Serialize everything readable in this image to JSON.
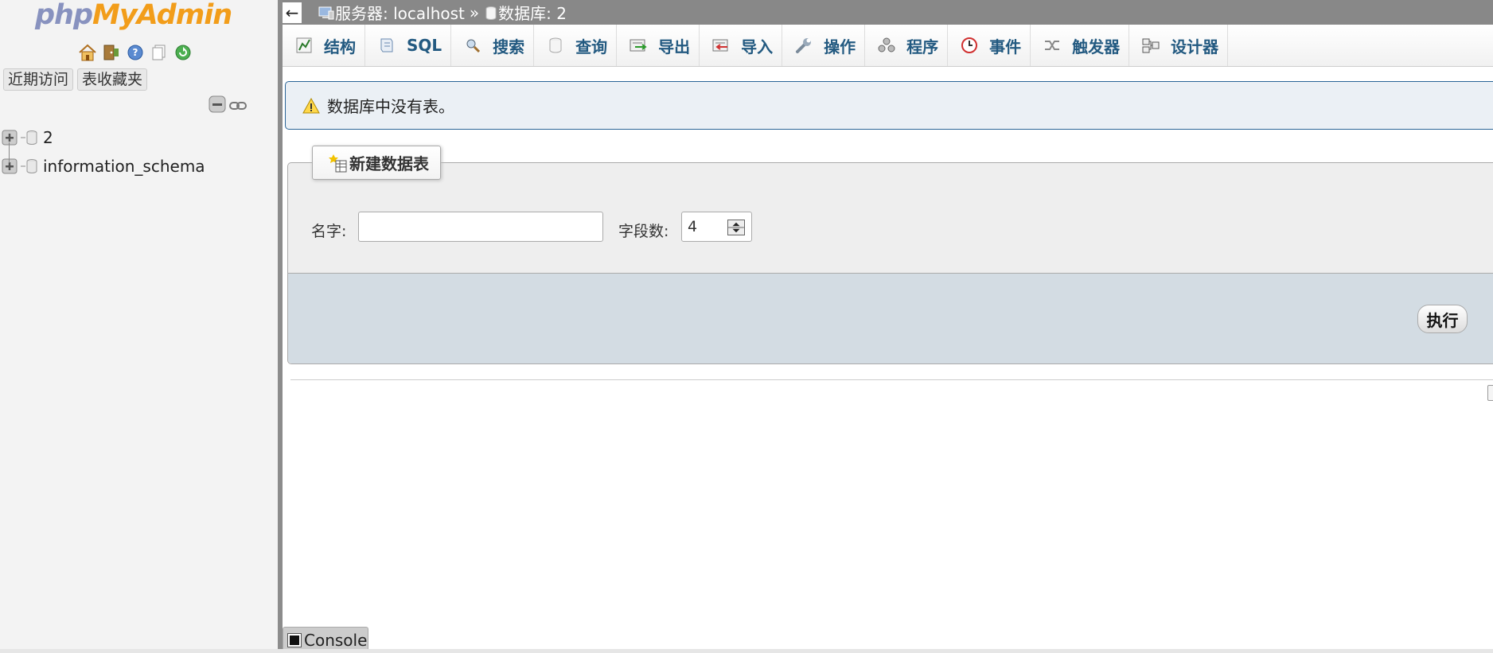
{
  "app": {
    "logo_php": "php",
    "logo_myadmin": "MyAdmin"
  },
  "nav": {
    "icons": [
      "home-icon",
      "exit-icon",
      "help-icon",
      "docs-icon",
      "reload-icon"
    ],
    "tabs": [
      {
        "label": "近期访问"
      },
      {
        "label": "表收藏夹"
      }
    ],
    "tools": [
      "collapse-all-icon",
      "link-with-main-icon"
    ],
    "databases": [
      {
        "label": "2"
      },
      {
        "label": "information_schema"
      }
    ]
  },
  "topbar": {
    "back_label": "←",
    "server_label": "服务器: localhost",
    "separator": "»",
    "database_label": "数据库: 2"
  },
  "menu": {
    "tabs": [
      {
        "label": "结构",
        "icon": "structure-icon"
      },
      {
        "label": "SQL",
        "icon": "sql-icon"
      },
      {
        "label": "搜索",
        "icon": "search-icon"
      },
      {
        "label": "查询",
        "icon": "query-icon"
      },
      {
        "label": "导出",
        "icon": "export-icon"
      },
      {
        "label": "导入",
        "icon": "import-icon"
      },
      {
        "label": "操作",
        "icon": "wrench-icon"
      },
      {
        "label": "程序",
        "icon": "routines-icon"
      },
      {
        "label": "事件",
        "icon": "events-icon"
      },
      {
        "label": "触发器",
        "icon": "triggers-icon"
      },
      {
        "label": "设计器",
        "icon": "designer-icon"
      }
    ]
  },
  "notice": {
    "text": "数据库中没有表。"
  },
  "create_table": {
    "legend": "新建数据表",
    "name_label": "名字:",
    "name_value": "",
    "columns_label": "字段数:",
    "columns_value": "4",
    "go_label": "执行"
  },
  "console": {
    "label": "Console"
  },
  "colors": {
    "nav_bg": "#f3f3f3",
    "topbar_bg": "#888888",
    "menu_text": "#235a81",
    "notice_bg": "#ebf0f5",
    "footer_bg": "#d3dce3",
    "logo_php": "#8892bf",
    "logo_myadmin": "#f29d1a"
  }
}
